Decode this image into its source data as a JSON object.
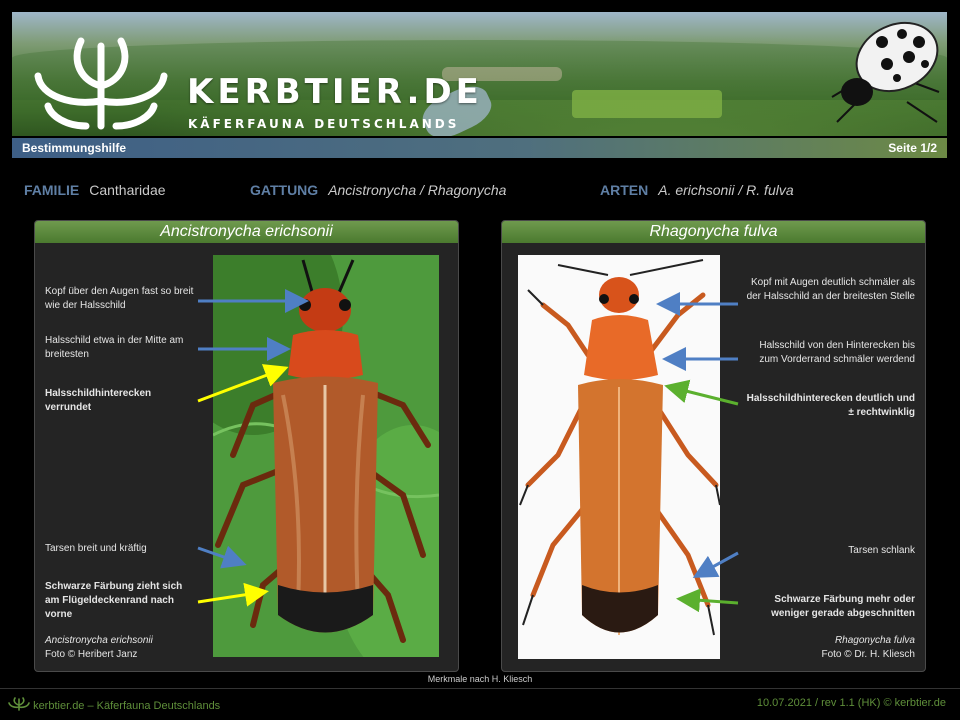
{
  "banner": {
    "logo_text": "KERBTIER.DE",
    "logo_sub": "KÄFERFAUNA DEUTSCHLANDS"
  },
  "titlebar": {
    "left": "Bestimmungshilfe",
    "right": "Seite 1/2"
  },
  "meta": {
    "familie_label": "FAMILIE",
    "familie_value": "Cantharidae",
    "gattung_label": "GATTUNG",
    "gattung_value": "Ancistronycha / Rhagonycha",
    "arten_label": "ARTEN",
    "arten_value": "A. erichsonii / R. fulva"
  },
  "left_panel": {
    "title": "Ancistronycha erichsonii",
    "notes": [
      "Kopf über den Augen fast so breit wie der Halsschild",
      "Halsschild etwa in der Mitte am breitesten",
      "Halsschildhinterecken verrundet",
      "Tarsen breit und kräftig",
      "Schwarze Färbung zieht sich am Flügeldeckenrand nach vorne"
    ],
    "caption_species": "Ancistronycha erichsonii",
    "caption_photo": "Foto © Heribert Janz"
  },
  "right_panel": {
    "title": "Rhagonycha fulva",
    "notes": [
      "Kopf mit Augen deutlich schmäler als der Halsschild an der breitesten Stelle",
      "Halsschild von den Hinterecken bis zum Vorderrand schmäler werdend",
      "Halsschildhinterecken deutlich und ± rechtwinklig",
      "Tarsen schlank",
      "Schwarze Färbung mehr oder weniger gerade abgeschnitten"
    ],
    "caption_species": "Rhagonycha fulva",
    "caption_photo": "Foto © Dr. H. Kliesch"
  },
  "credit": "Merkmale nach H. Kliesch",
  "footer": {
    "left": "kerbtier.de – Käferfauna Deutschlands",
    "right": "10.07.2021 / rev 1.1 (HK) © kerbtier.de"
  },
  "colors": {
    "arrow_blue": "#4f7fc4",
    "arrow_yellow": "#ffff00",
    "arrow_green": "#5bb02e",
    "panel_header": "#5e8a3e",
    "label_blue": "#5f7fa5"
  },
  "icons": [
    "kerbtier-logo-icon",
    "beetle-icon"
  ]
}
